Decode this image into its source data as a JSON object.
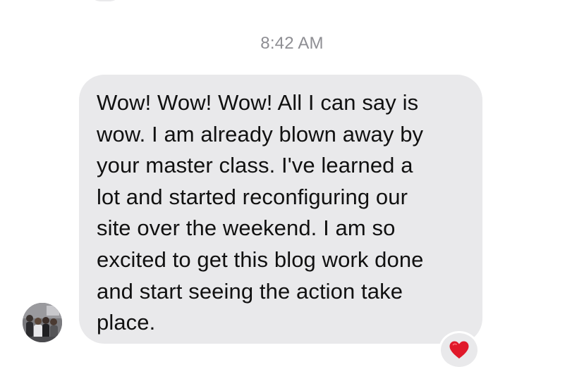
{
  "timestamp": "8:42 AM",
  "message": {
    "text": "Wow! Wow! Wow! All I can say is\nwow. I am already blown away by\nyour master class. I've learned a\nlot and started reconfiguring our\nsite over the weekend. I am so\nexcited to get this blog work done\nand start seeing the action take\nplace.",
    "bubble_color": "#e9e9eb",
    "text_color": "#111111"
  },
  "reaction": {
    "icon": "red-heart-icon",
    "color": "#e0192a"
  },
  "sender": {
    "avatar": "group-photo-avatar"
  },
  "colors": {
    "background": "#ffffff",
    "timestamp": "#8e8e93"
  }
}
